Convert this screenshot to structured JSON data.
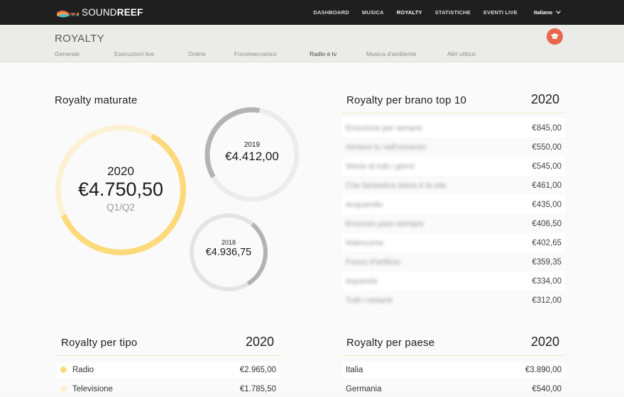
{
  "brand": {
    "name_a": "SOUND",
    "name_b": "REEF"
  },
  "nav": {
    "items": [
      "DASHBOARD",
      "MUSICA",
      "ROYALTY",
      "STATISTICHE",
      "EVENTI LIVE"
    ],
    "active": "ROYALTY"
  },
  "language": {
    "label": "Italiano"
  },
  "page": {
    "title": "ROYALTY"
  },
  "tabs": [
    "Generale",
    "Esecuzioni live",
    "Online",
    "Fonomeccanico",
    "Radio e tv",
    "Musica d'ambiente",
    "Altri utilizzi"
  ],
  "matured": {
    "title": "Royalty maturate",
    "current": {
      "year": "2020",
      "amount": "€4.750,50",
      "period": "Q1/Q2",
      "fill": 0.6,
      "color": "#fcd97a",
      "track": "#fdf1d3"
    },
    "y2019": {
      "year": "2019",
      "amount": "€4.412,00",
      "fill": 0.36,
      "color": "#b3b3b3",
      "track": "#ececec"
    },
    "y2018": {
      "year": "2018",
      "amount": "€4.936,75",
      "fill": 0.3,
      "color": "#b3b3b3",
      "track": "#e4e4e4"
    }
  },
  "top10": {
    "title": "Royalty per brano top 10",
    "year": "2020",
    "rows": [
      {
        "name": "Emozione per sempre",
        "value": "€845,00"
      },
      {
        "name": "Almeno tu nell'universo",
        "value": "€550,00"
      },
      {
        "name": "Storie di tutti i giorni",
        "value": "€545,00"
      },
      {
        "name": "Che fantastica storia è la vita",
        "value": "€461,00"
      },
      {
        "name": "Acquarello",
        "value": "€435,00"
      },
      {
        "name": "Emocion para siempre",
        "value": "€406,50"
      },
      {
        "name": "Malinconia",
        "value": "€402,65"
      },
      {
        "name": "Fuoco d'artificio",
        "value": "€359,35"
      },
      {
        "name": "Aquarela",
        "value": "€334,00"
      },
      {
        "name": "Tutti i restanti",
        "value": "€312,00"
      }
    ]
  },
  "by_type": {
    "title": "Royalty per tipo",
    "year": "2020",
    "rows": [
      {
        "name": "Radio",
        "value": "€2.965,00",
        "color": "#fcd97a"
      },
      {
        "name": "Televisione",
        "value": "€1.785,50",
        "color": "#fdf0cf"
      }
    ]
  },
  "by_country": {
    "title": "Royalty per paese",
    "year": "2020",
    "rows": [
      {
        "name": "Italia",
        "value": "€3.890,00"
      },
      {
        "name": "Germania",
        "value": "€540,00"
      }
    ]
  }
}
